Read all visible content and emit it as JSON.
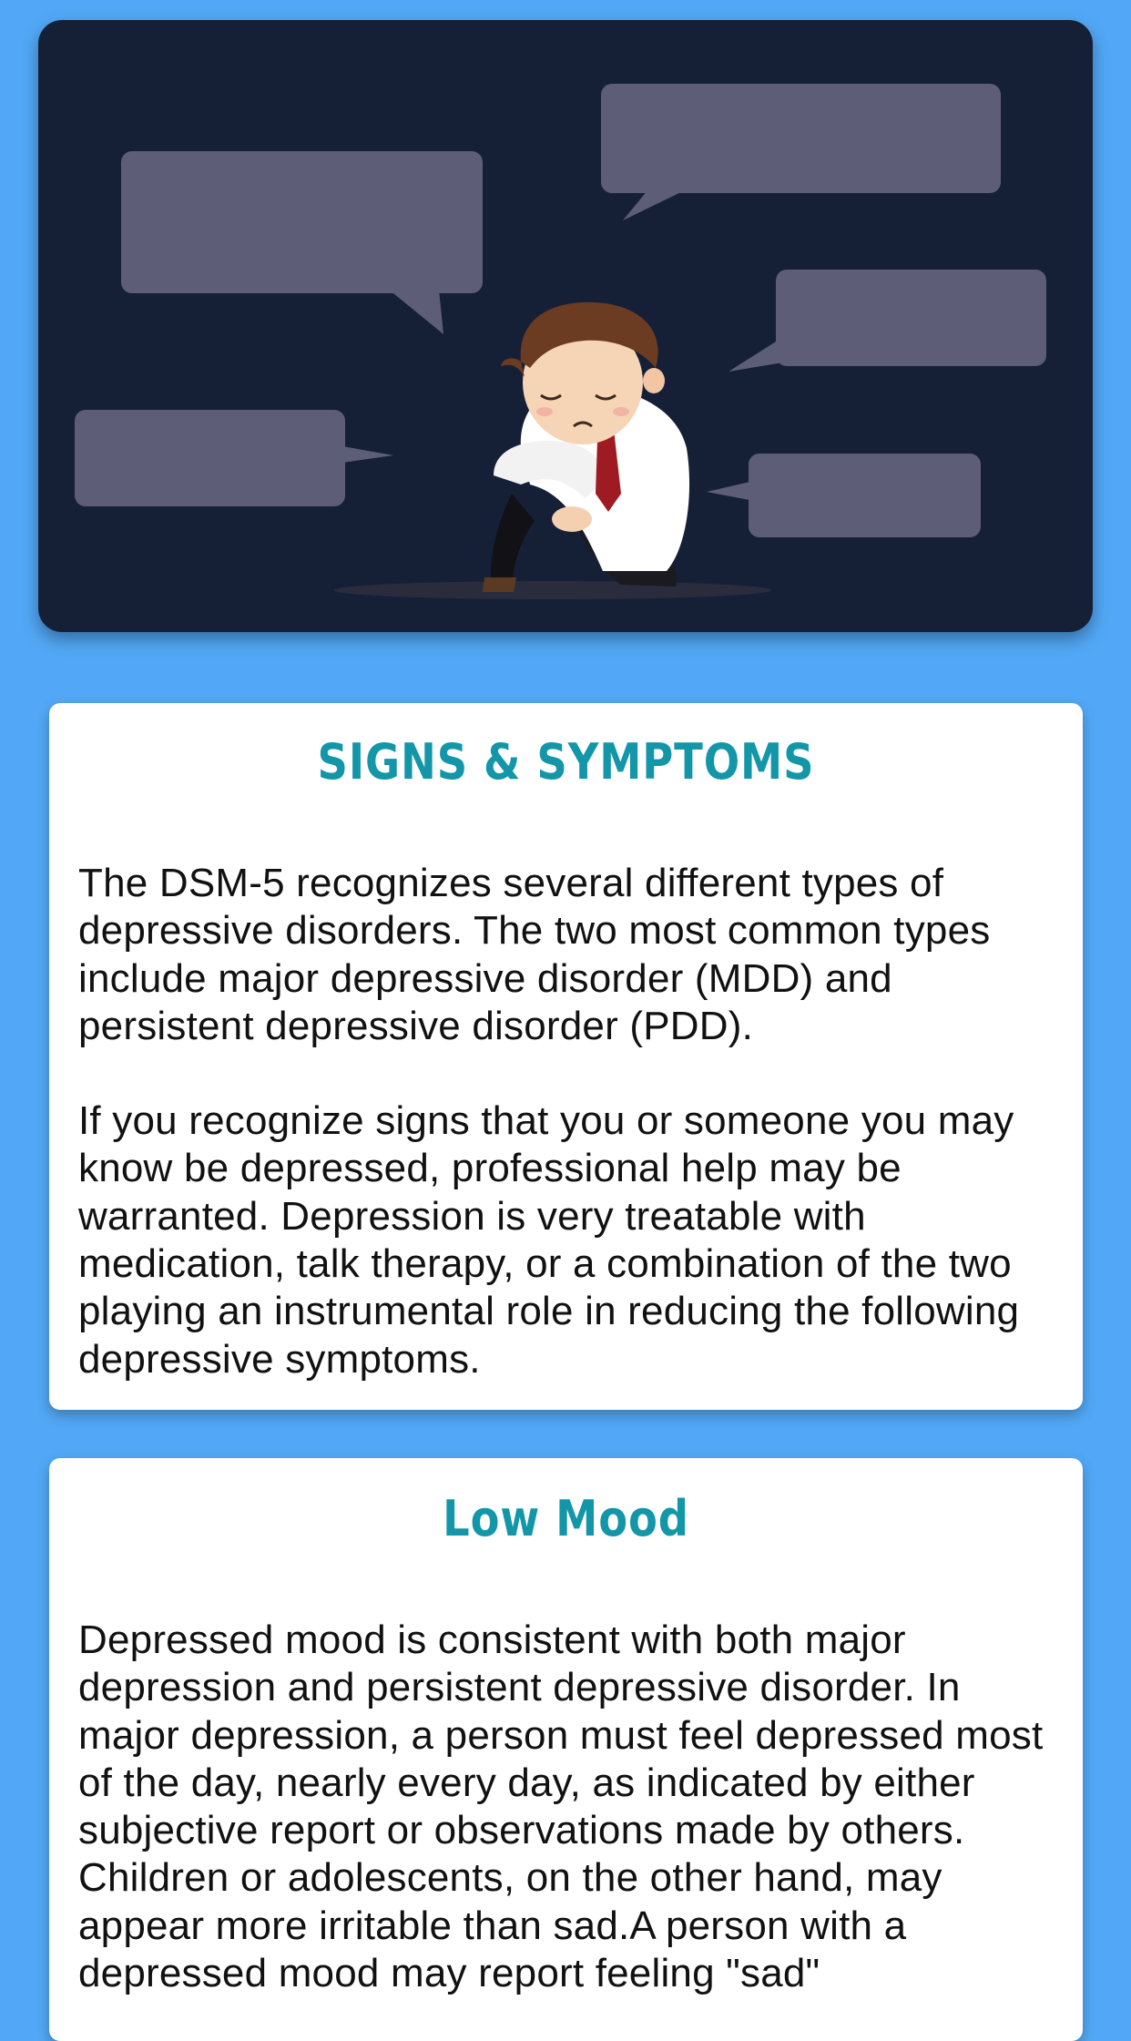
{
  "hero": {
    "image": "sad-man-with-speech-bubbles-illustration",
    "background_color": "#152037",
    "bubble_color": "#5e5d78"
  },
  "sections": [
    {
      "title": "SIGNS & SYMPTOMS",
      "paragraphs": [
        "The DSM-5 recognizes several different types of depressive disorders. The two most common types include major depressive disorder (MDD) and persistent depressive disorder (PDD).",
        "If you recognize signs that you or someone you may know be depressed, professional help may be warranted. Depression is very treatable with medication, talk therapy, or a combination of the two playing an instrumental role in reducing the following depressive symptoms."
      ]
    },
    {
      "title": "Low Mood",
      "paragraphs": [
        "Depressed mood is consistent with both major depression and persistent depressive disorder. In major depression, a person must feel depressed most of the day, nearly every day, as indicated by either subjective report or observations made by others. Children or adolescents, on the other hand, may appear more irritable than sad.A person with a depressed mood may report feeling \"sad\""
      ]
    }
  ],
  "colors": {
    "page_background": "#52a8f6",
    "title_color": "#1296a8",
    "card_background": "#ffffff",
    "text_color": "#111111"
  }
}
